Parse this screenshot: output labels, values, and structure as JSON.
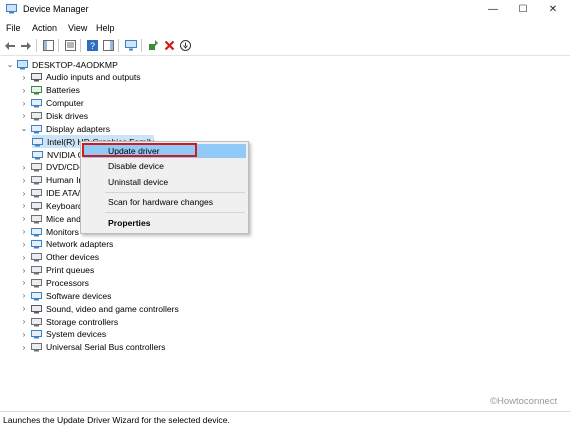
{
  "window": {
    "title": "Device Manager",
    "minimize": "—",
    "maximize": "☐",
    "close": "✕"
  },
  "menu": [
    "File",
    "Action",
    "View",
    "Help"
  ],
  "tree": {
    "root": "DESKTOP-4AODKMP",
    "items": [
      {
        "label": "Audio inputs and outputs",
        "icon": "speaker-icon",
        "color": "#5a5a5a"
      },
      {
        "label": "Batteries",
        "icon": "battery-icon",
        "color": "#3a8d3a"
      },
      {
        "label": "Computer",
        "icon": "computer-icon",
        "color": "#3b84c9"
      },
      {
        "label": "Disk drives",
        "icon": "disk-icon",
        "color": "#707070"
      },
      {
        "label": "Display adapters",
        "icon": "display-adapter-icon",
        "color": "#3b84c9"
      },
      {
        "label": "Intel(R) HD Graphics Family",
        "icon": "display-adapter-icon",
        "color": "#3b84c9"
      },
      {
        "label": "NVIDIA GeForce",
        "icon": "display-adapter-icon",
        "color": "#3b84c9"
      },
      {
        "label": "DVD/CD-ROM drives",
        "icon": "dvd-icon",
        "color": "#707070"
      },
      {
        "label": "Human Interface Devices",
        "icon": "hid-icon",
        "color": "#707070"
      },
      {
        "label": "IDE ATA/ATAPI controllers",
        "icon": "ide-icon",
        "color": "#707070"
      },
      {
        "label": "Keyboards",
        "icon": "keyboard-icon",
        "color": "#707070"
      },
      {
        "label": "Mice and other pointing devices",
        "icon": "mouse-icon",
        "color": "#707070"
      },
      {
        "label": "Monitors",
        "icon": "monitor-icon",
        "color": "#3b84c9"
      },
      {
        "label": "Network adapters",
        "icon": "network-icon",
        "color": "#3b84c9"
      },
      {
        "label": "Other devices",
        "icon": "other-devices-icon",
        "color": "#707070"
      },
      {
        "label": "Print queues",
        "icon": "printer-icon",
        "color": "#707070"
      },
      {
        "label": "Processors",
        "icon": "processor-icon",
        "color": "#707070"
      },
      {
        "label": "Software devices",
        "icon": "software-device-icon",
        "color": "#3b84c9"
      },
      {
        "label": "Sound, video and game controllers",
        "icon": "sound-icon",
        "color": "#5a5a5a"
      },
      {
        "label": "Storage controllers",
        "icon": "storage-icon",
        "color": "#707070"
      },
      {
        "label": "System devices",
        "icon": "system-icon",
        "color": "#3b84c9"
      },
      {
        "label": "Universal Serial Bus controllers",
        "icon": "usb-icon",
        "color": "#707070"
      }
    ]
  },
  "context_menu": {
    "items": [
      "Update driver",
      "Disable device",
      "Uninstall device",
      "Scan for hardware changes",
      "Properties"
    ],
    "highlighted": "Update driver"
  },
  "status_bar": "Launches the Update Driver Wizard for the selected device.",
  "watermark": "©Howtoconnect",
  "colors": {
    "accent": "#3b84c9",
    "highlight": "#91c9f7",
    "red_box": "#d11a1a"
  }
}
